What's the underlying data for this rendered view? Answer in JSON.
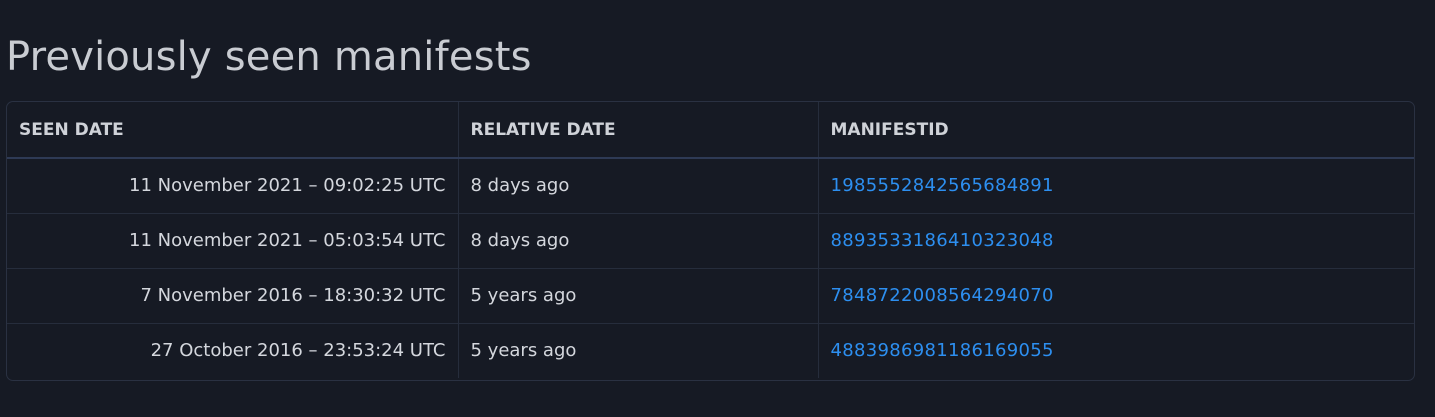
{
  "page": {
    "title": "Previously seen manifests"
  },
  "table": {
    "headers": [
      "SEEN DATE",
      "RELATIVE DATE",
      "MANIFESTID"
    ],
    "rows": [
      {
        "seen_date": "11 November 2021 – 09:02:25 UTC",
        "relative_date": "8 days ago",
        "manifest_id": "1985552842565684891"
      },
      {
        "seen_date": "11 November 2021 – 05:03:54 UTC",
        "relative_date": "8 days ago",
        "manifest_id": "8893533186410323048"
      },
      {
        "seen_date": "7 November 2016 – 18:30:32 UTC",
        "relative_date": "5 years ago",
        "manifest_id": "7848722008564294070"
      },
      {
        "seen_date": "27 October 2016 – 23:53:24 UTC",
        "relative_date": "5 years ago",
        "manifest_id": "4883986981186169055"
      }
    ]
  },
  "colors": {
    "background": "#161a24",
    "text": "#d4d7dd",
    "link": "#2d8ff0",
    "border": "#2a3142"
  }
}
